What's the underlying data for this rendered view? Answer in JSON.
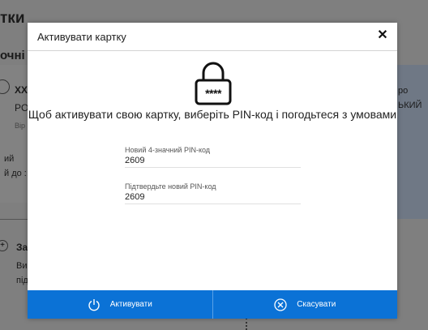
{
  "background": {
    "title": "тки",
    "subtitle": "очні",
    "left_texts": [
      "XX",
      "PO",
      "Bip",
      "ий",
      "й до : 2",
      "За",
      "Ви",
      "під"
    ],
    "right_texts": [
      "ро",
      "ЬКИЙ"
    ]
  },
  "modal": {
    "title": "Активувати картку",
    "close_icon": "close-icon",
    "lock_text": "****",
    "heading": "Щоб активувати свою картку, виберіть PIN-код і погодьтеся з умовами",
    "fields": [
      {
        "label": "Новий 4-значний PIN-код",
        "value": "2609"
      },
      {
        "label": "Підтвердьте новий PIN-код",
        "value": "2609"
      }
    ],
    "buttons": {
      "activate": "Активувати",
      "cancel": "Скасувати"
    }
  },
  "colors": {
    "primary": "#0b72d6",
    "overlay": "#7f7f7f"
  }
}
